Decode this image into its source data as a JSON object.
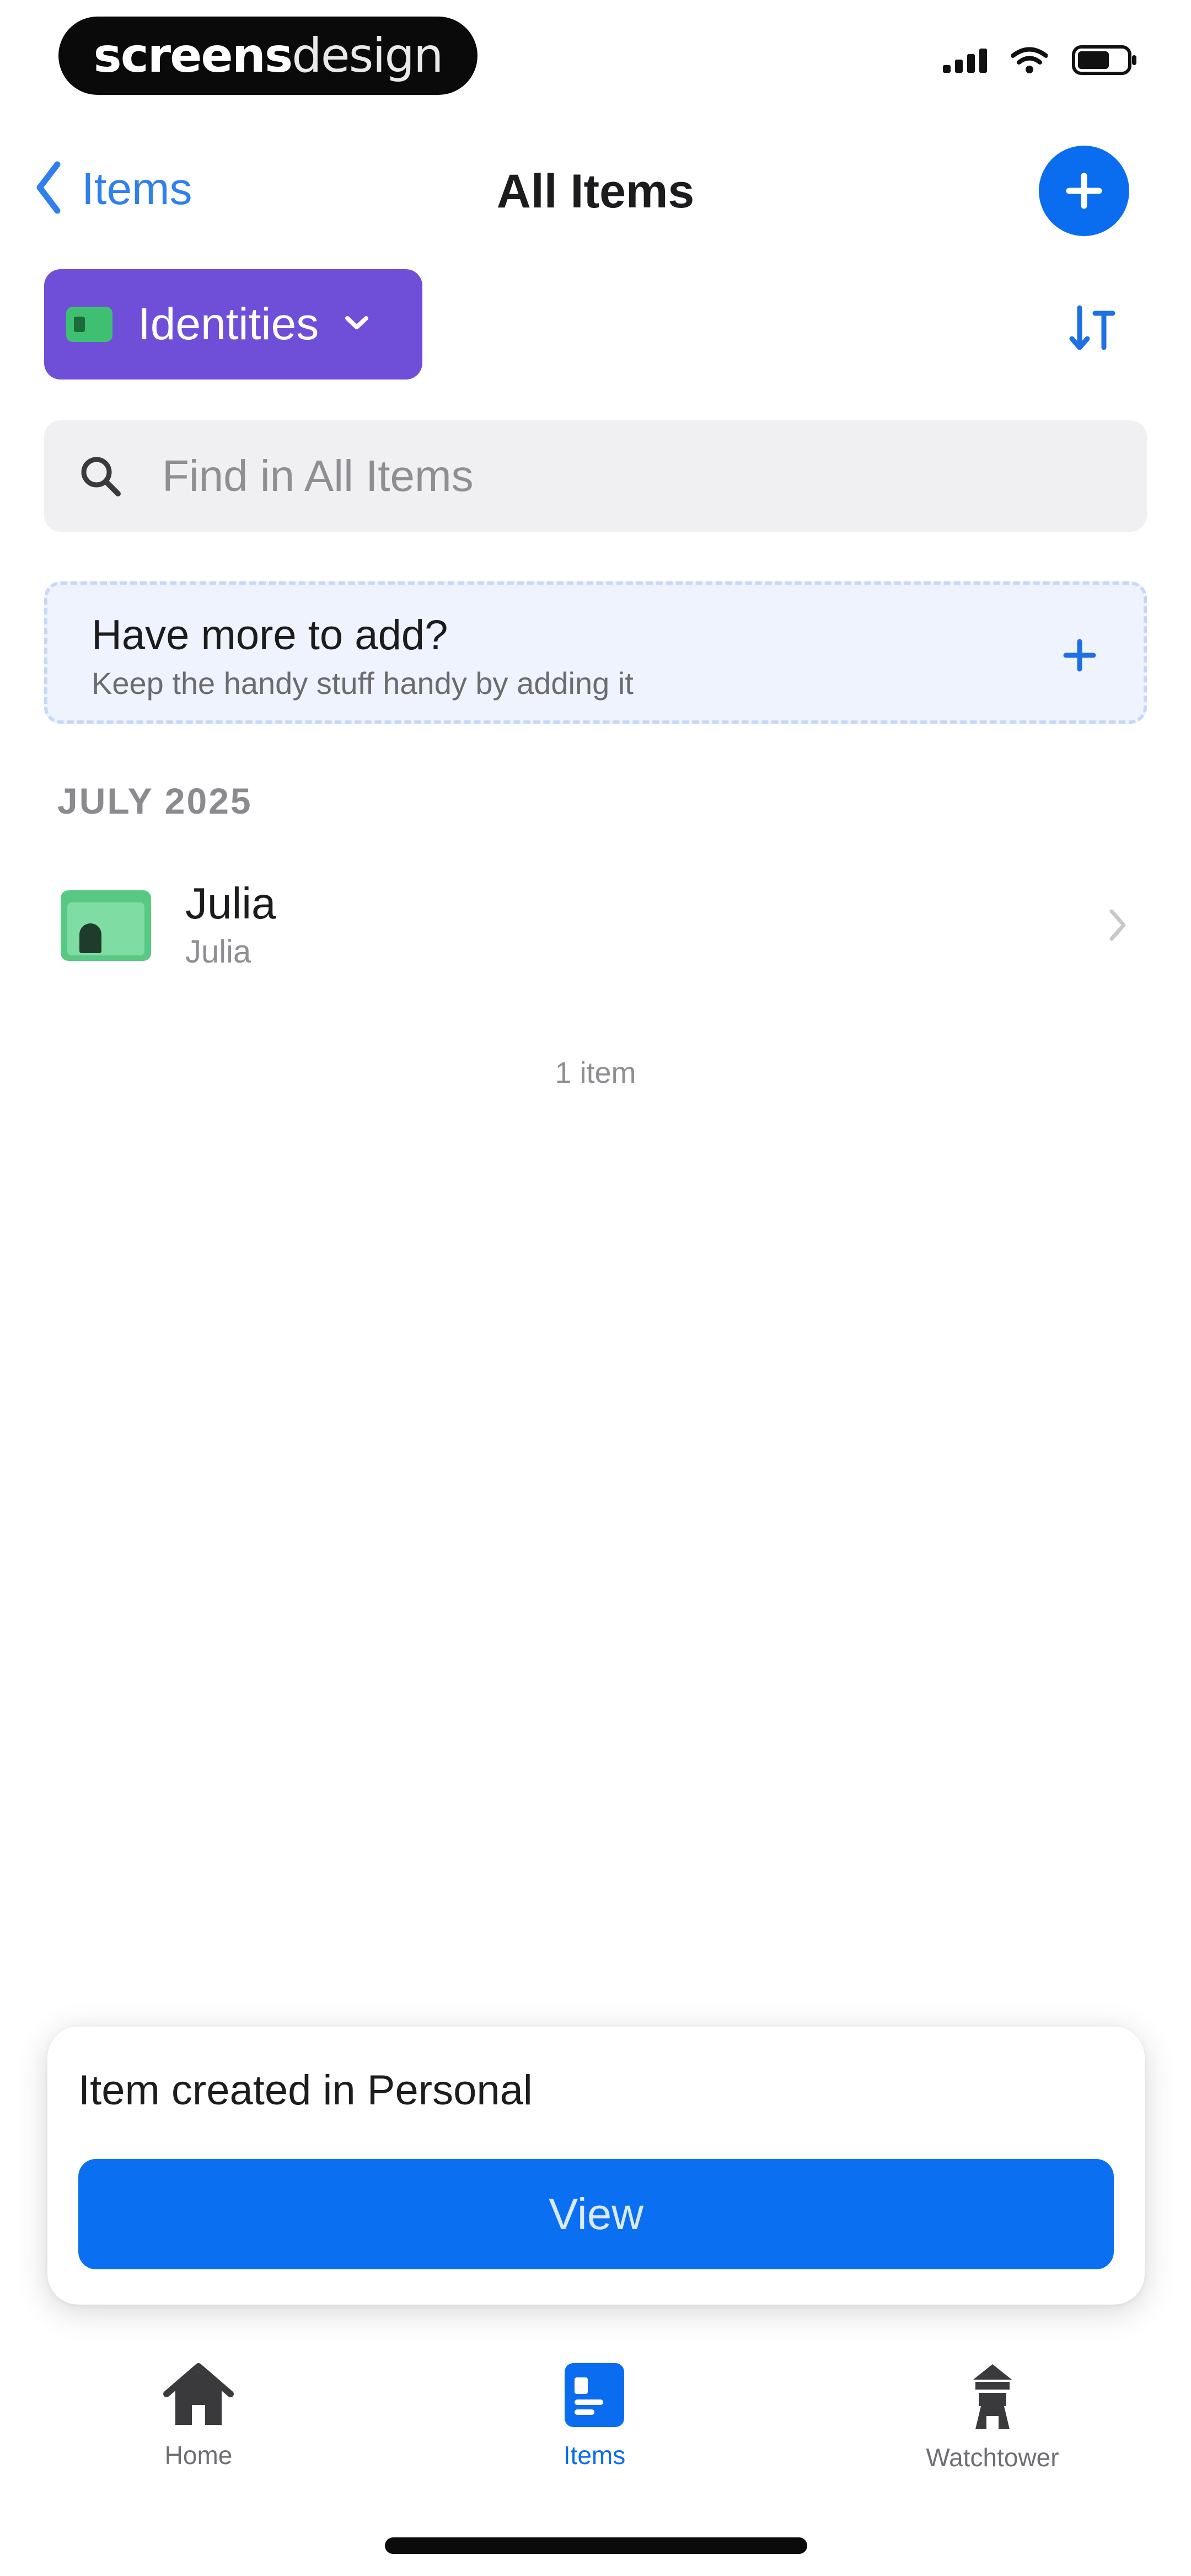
{
  "status_bar": {
    "brand_bold": "screens",
    "brand_light": "design",
    "signal_icon": "cellular-signal-icon",
    "wifi_icon": "wifi-icon",
    "battery_icon": "battery-icon"
  },
  "nav": {
    "back_label": "Items",
    "title": "All Items",
    "add_icon": "plus-icon"
  },
  "filter": {
    "selected": "Identities",
    "chip_color": "#6f4fd7",
    "sort_icon": "sort-icon"
  },
  "search": {
    "placeholder": "Find in All Items"
  },
  "add_prompt": {
    "title": "Have more to add?",
    "subtitle": "Keep the handy stuff handy by adding it"
  },
  "list": {
    "section_header": "JULY 2025",
    "items": [
      {
        "title": "Julia",
        "subtitle": "Julia",
        "icon": "identity-card-icon"
      }
    ],
    "count_label": "1 item"
  },
  "toast": {
    "message": "Item created in Personal",
    "button_label": "View",
    "button_color": "#0a6ff0"
  },
  "tabs": [
    {
      "label": "Home",
      "icon": "home-icon",
      "active": false
    },
    {
      "label": "Items",
      "icon": "items-icon",
      "active": true
    },
    {
      "label": "Watchtower",
      "icon": "watchtower-icon",
      "active": false
    }
  ],
  "colors": {
    "accent": "#0a6df0",
    "link": "#2f80ed"
  }
}
